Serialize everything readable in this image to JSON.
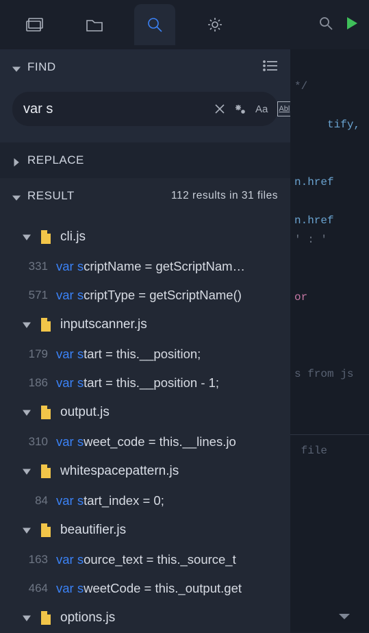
{
  "find": {
    "label": "FIND",
    "query": "var s",
    "caseOptionLabel": "Aa",
    "regexOptionLabel": "Abl"
  },
  "replace": {
    "label": "REPLACE"
  },
  "result": {
    "label": "RESULT",
    "summary": "112 results in 31 files"
  },
  "files": [
    {
      "name": "cli.js",
      "matches": [
        {
          "line": "331",
          "pre": "",
          "hl": "var s",
          "post": "criptName = getScriptNam…"
        },
        {
          "line": "571",
          "pre": "",
          "hl": "var s",
          "post": "criptType = getScriptName()"
        }
      ]
    },
    {
      "name": "inputscanner.js",
      "matches": [
        {
          "line": "179",
          "pre": "",
          "hl": "var s",
          "post": "tart = this.__position;"
        },
        {
          "line": "186",
          "pre": "",
          "hl": "var s",
          "post": "tart = this.__position - 1;"
        }
      ]
    },
    {
      "name": "output.js",
      "matches": [
        {
          "line": "310",
          "pre": "",
          "hl": "var s",
          "post": "weet_code = this.__lines.jo"
        }
      ]
    },
    {
      "name": "whitespacepattern.js",
      "matches": [
        {
          "line": "84",
          "pre": "",
          "hl": "var s",
          "post": "tart_index = 0;"
        }
      ]
    },
    {
      "name": "beautifier.js",
      "matches": [
        {
          "line": "163",
          "pre": "",
          "hl": "var s",
          "post": "ource_text = this._source_t"
        },
        {
          "line": "464",
          "pre": "",
          "hl": "var s",
          "post": "weetCode = this._output.get"
        }
      ]
    },
    {
      "name": "options.js",
      "matches": []
    }
  ],
  "background": {
    "l1": "*/",
    "l2": "tify,",
    "l3": "n.href",
    "l4": "n.href",
    "l5": "' : '",
    "l6": "or",
    "l7": "s from js",
    "l8": "file"
  }
}
